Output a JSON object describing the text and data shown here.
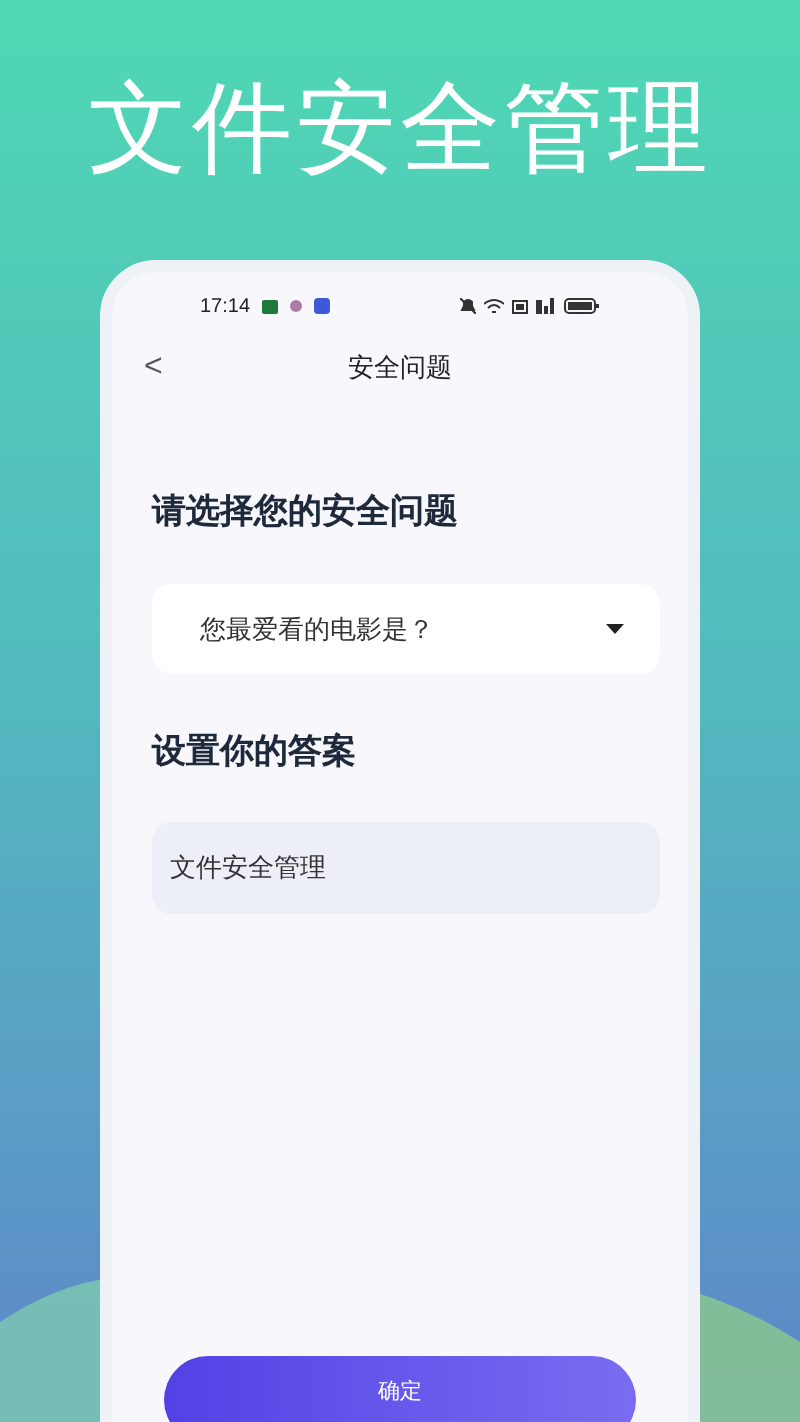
{
  "headline": "文件安全管理",
  "status_bar": {
    "time": "17:14"
  },
  "nav": {
    "back": "<",
    "title": "安全问题"
  },
  "question": {
    "label": "请选择您的安全问题",
    "selected": "您最爱看的电影是？"
  },
  "answer": {
    "label": "设置你的答案",
    "value": "文件安全管理"
  },
  "confirm_button": "确定"
}
